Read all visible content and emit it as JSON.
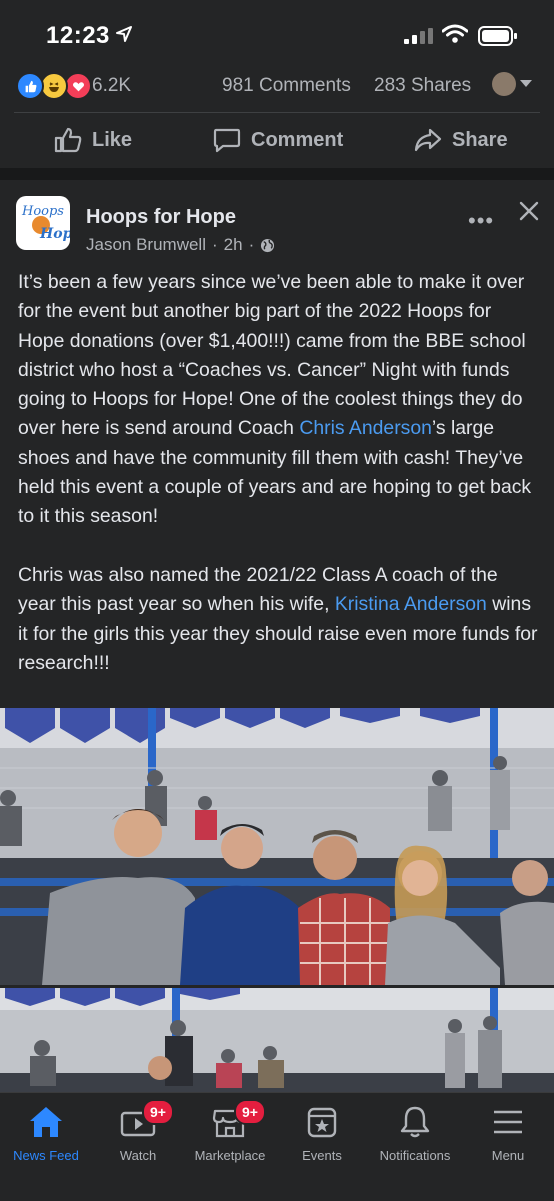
{
  "status_bar": {
    "time": "12:23"
  },
  "reactions": {
    "count": "6.2K",
    "comments": "981 Comments",
    "shares": "283 Shares"
  },
  "actions": {
    "like": "Like",
    "comment": "Comment",
    "share": "Share"
  },
  "post": {
    "page_name": "Hoops for Hope",
    "author": "Jason Brumwell",
    "time": "2h",
    "paragraph1_a": "It’s been a few years since we’ve been able to make it over for the event but another big part of the 2022 Hoops for Hope donations (over $1,400!!!) came from the BBE school district who host a “Coaches vs. Cancer” Night with funds going to Hoops for Hope! One of the coolest things they do over here is send around Coach ",
    "mention1": "Chris Anderson",
    "paragraph1_b": "’s large shoes and have the community fill them with cash! They’ve held this event a couple of years and are hoping to get back to it this season!",
    "paragraph2_a": "Chris was also named the 2021/22 Class A coach of the year this past year so when his wife, ",
    "mention2": "Kristina Anderson",
    "paragraph2_b": " wins it for the girls this year they should raise even more funds for research!!!",
    "avatar_logo_line1": "Hoops",
    "avatar_logo_line2": "Hope"
  },
  "nav": {
    "items": [
      {
        "label": "News Feed",
        "icon": "home-icon",
        "active": true
      },
      {
        "label": "Watch",
        "icon": "watch-icon",
        "badge": "9+"
      },
      {
        "label": "Marketplace",
        "icon": "marketplace-icon",
        "badge": "9+"
      },
      {
        "label": "Events",
        "icon": "events-icon"
      },
      {
        "label": "Notifications",
        "icon": "bell-icon"
      },
      {
        "label": "Menu",
        "icon": "menu-icon"
      }
    ]
  },
  "colors": {
    "background": "#242526",
    "accent": "#2d88ff",
    "link": "#4b9bf0",
    "badge": "#e41e3f"
  }
}
